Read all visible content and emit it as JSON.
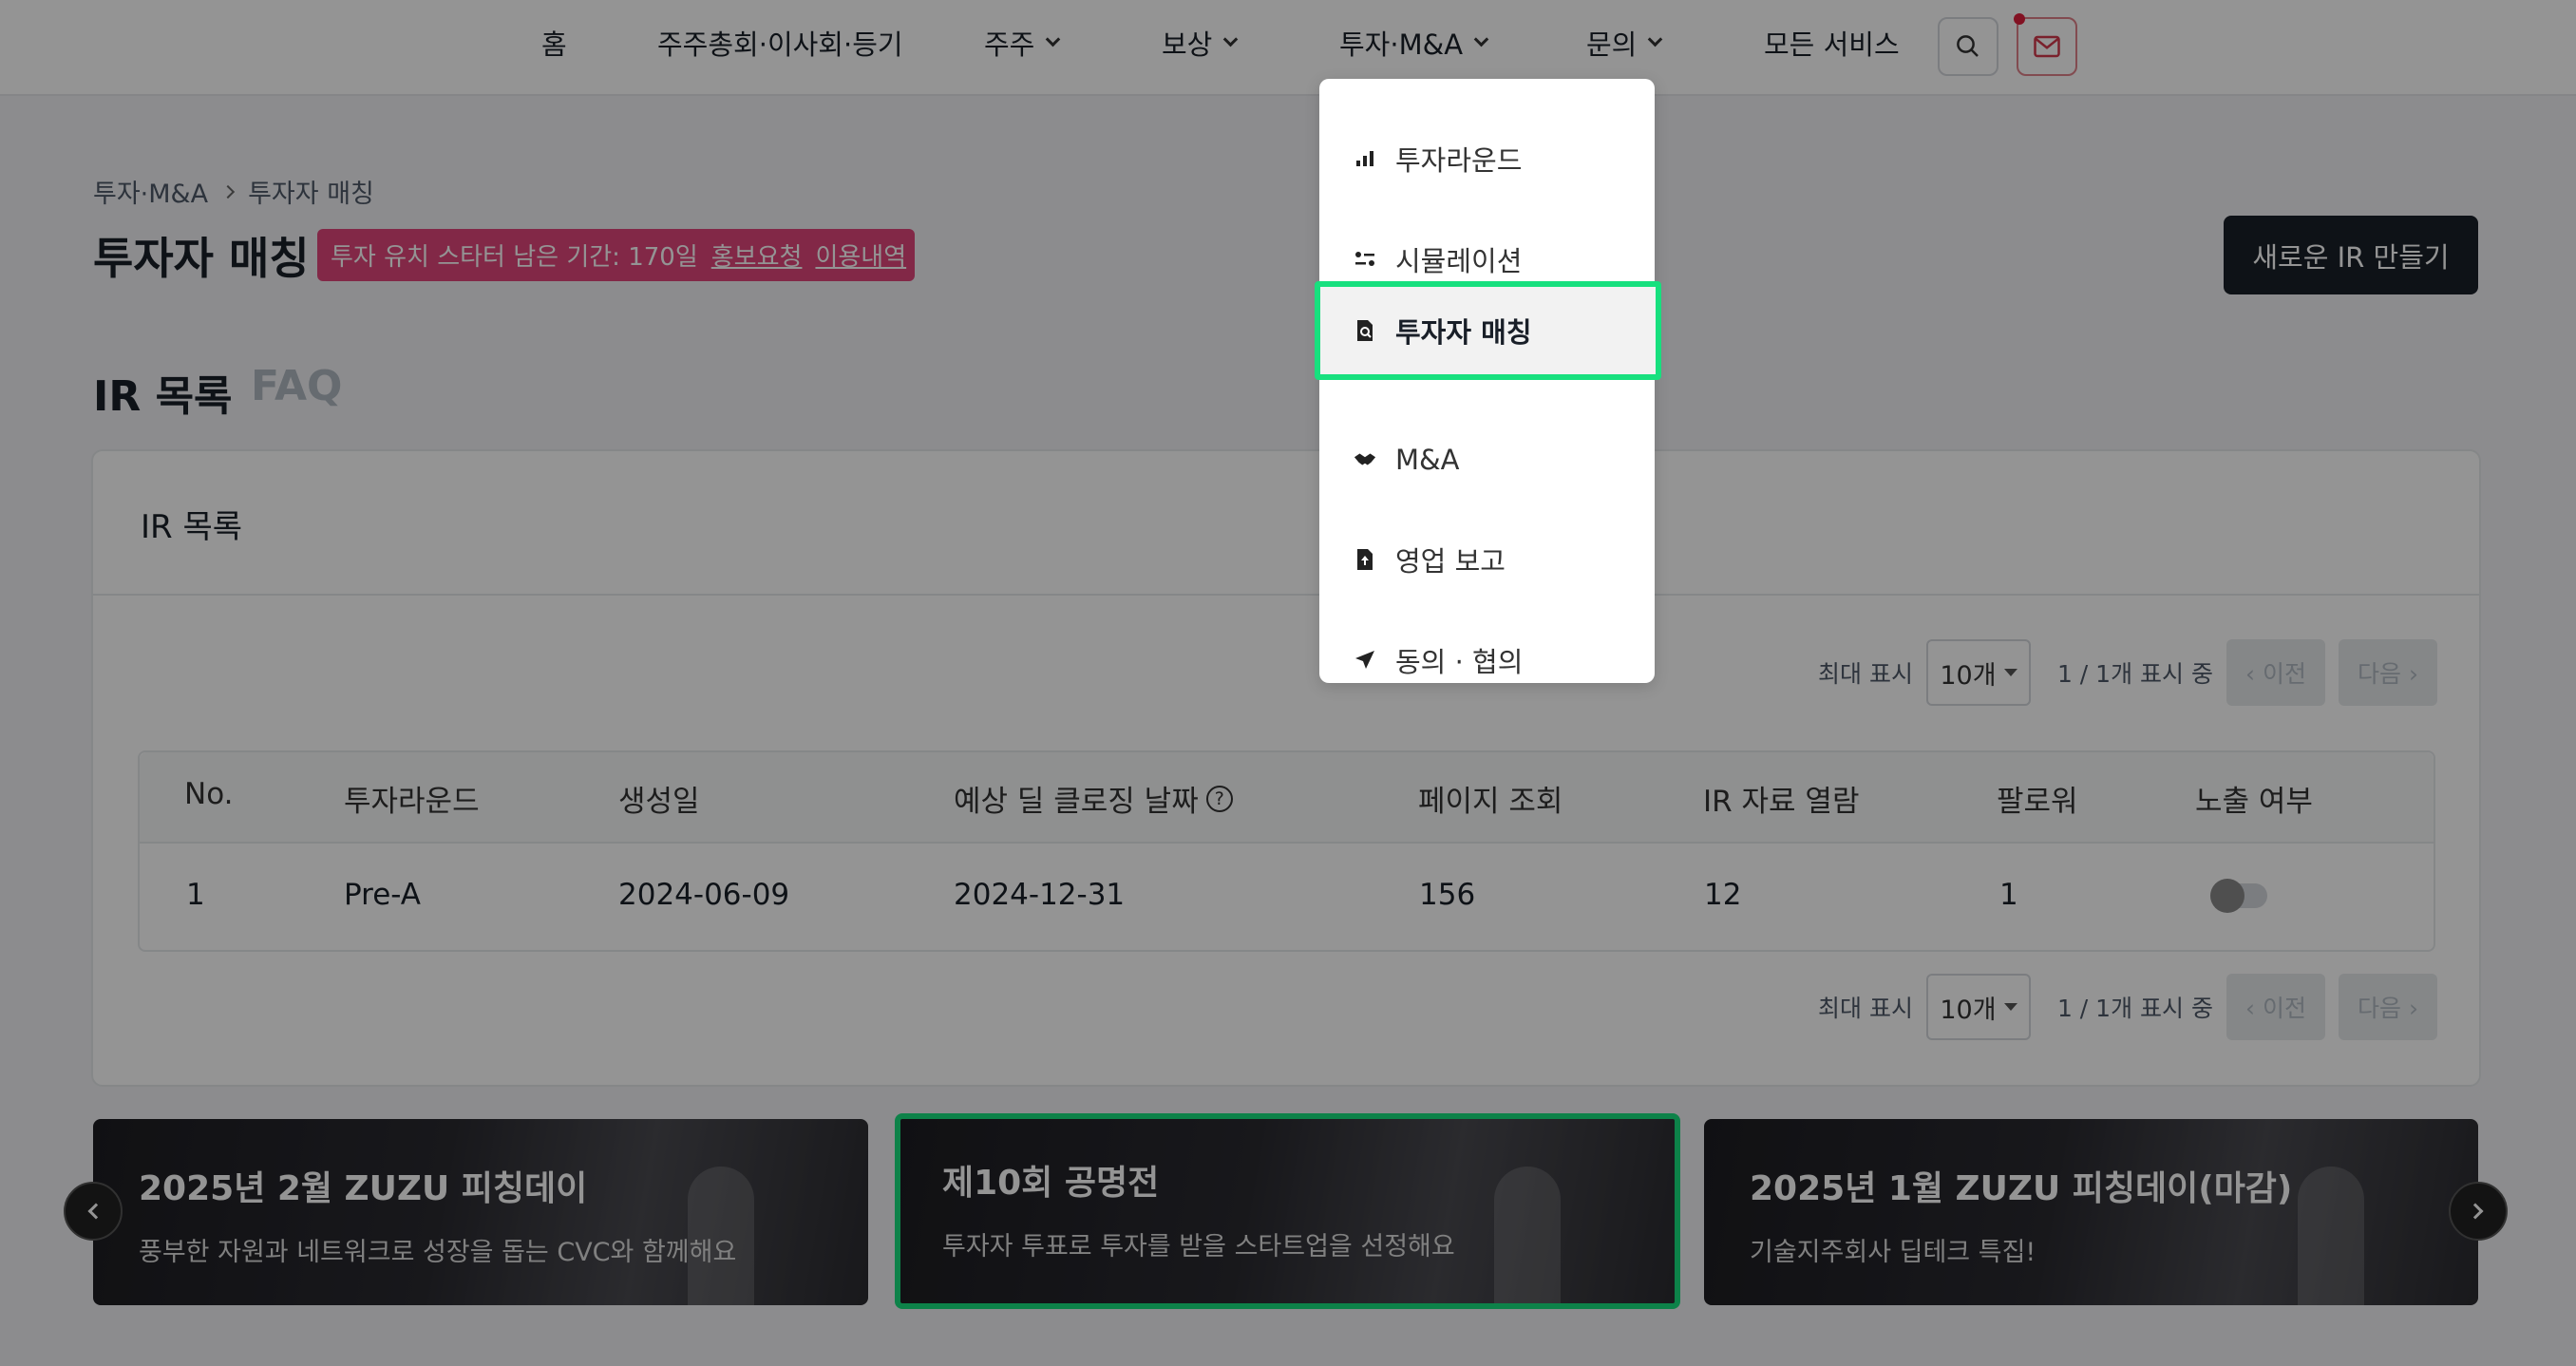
{
  "nav": {
    "items": [
      "홈",
      "주주총회·이사회·등기",
      "주주",
      "보상",
      "투자·M&A",
      "문의",
      "모든 서비스"
    ]
  },
  "breadcrumb": {
    "parent": "투자·M&A",
    "current": "투자자 매칭"
  },
  "page": {
    "title": "투자자 매칭",
    "promo_text": "투자 유치 스타터 남은 기간: 170일",
    "promo_link1": "홍보요청",
    "promo_link2": "이용내역",
    "new_ir_button": "새로운 IR 만들기"
  },
  "tabs": [
    "IR 목록",
    "FAQ"
  ],
  "ir_card": {
    "title": "IR 목록"
  },
  "pager": {
    "max_label": "최대 표시",
    "per_page": "10개",
    "status": "1 / 1개 표시 중",
    "prev": "‹ 이전",
    "next": "다음 ›"
  },
  "table": {
    "headers": [
      "No.",
      "투자라운드",
      "생성일",
      "예상 딜 클로징 날짜",
      "페이지 조회",
      "IR 자료 열람",
      "팔로워",
      "노출 여부"
    ],
    "help_glyph": "?",
    "rows": [
      {
        "no": "1",
        "round": "Pre-A",
        "created": "2024-06-09",
        "closing": "2024-12-31",
        "views": "156",
        "ir_opens": "12",
        "followers": "1",
        "visible": false
      }
    ]
  },
  "banners": [
    {
      "title": "2025년 2월 ZUZU 피칭데이",
      "subtitle": "풍부한 자원과 네트워크로 성장을 돕는 CVC와 함께해요"
    },
    {
      "title": "제10회 공명전",
      "subtitle": "투자자 투표로 투자를 받을 스타트업을 선정해요"
    },
    {
      "title": "2025년 1월 ZUZU 피칭데이(마감)",
      "subtitle": "기술지주회사 딥테크 특집!"
    }
  ],
  "dropdown": {
    "items": [
      {
        "label": "투자라운드",
        "icon": "bar-chart-icon"
      },
      {
        "label": "시뮬레이션",
        "icon": "sliders-icon"
      },
      {
        "label": "투자자 매칭",
        "icon": "document-search-icon"
      },
      {
        "label": "M&A",
        "icon": "handshake-icon"
      },
      {
        "label": "영업 보고",
        "icon": "file-upload-icon"
      },
      {
        "label": "동의 · 협의",
        "icon": "send-icon"
      }
    ]
  },
  "colors": {
    "accent_green": "#17e07e",
    "promo_pink": "#e0457a",
    "dark": "#191f28"
  }
}
